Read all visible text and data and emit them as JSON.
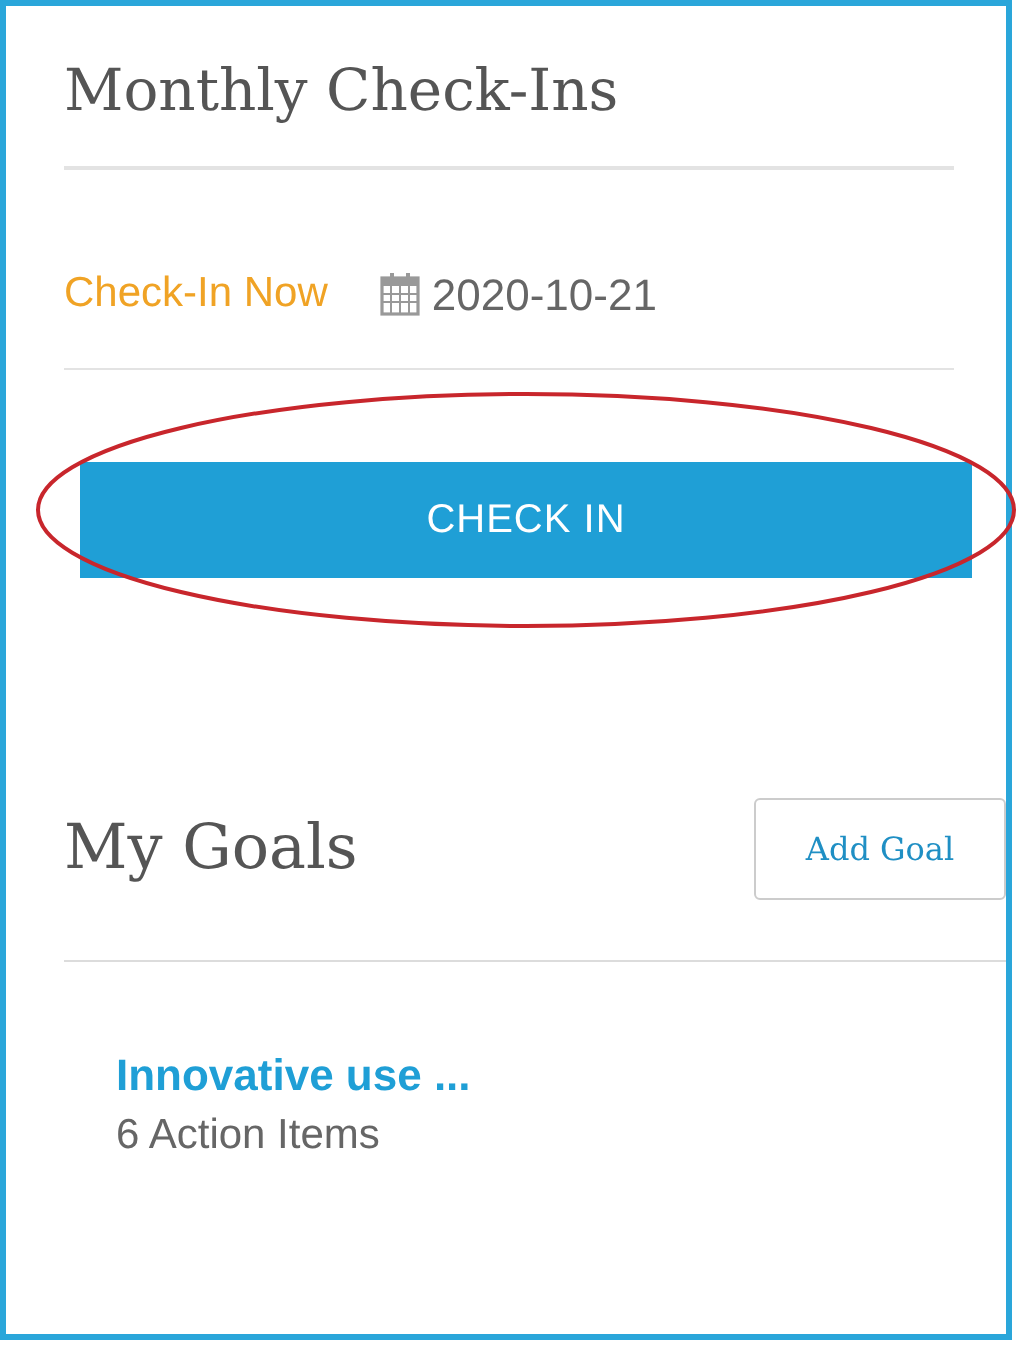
{
  "checkins": {
    "title": "Monthly Check-Ins",
    "status": "Check-In Now",
    "date": "2020-10-21",
    "button": "CHECK IN"
  },
  "goals": {
    "title": "My Goals",
    "add_button": "Add Goal",
    "items": [
      {
        "title": "Innovative use ...",
        "subtitle": "6 Action Items"
      }
    ]
  }
}
